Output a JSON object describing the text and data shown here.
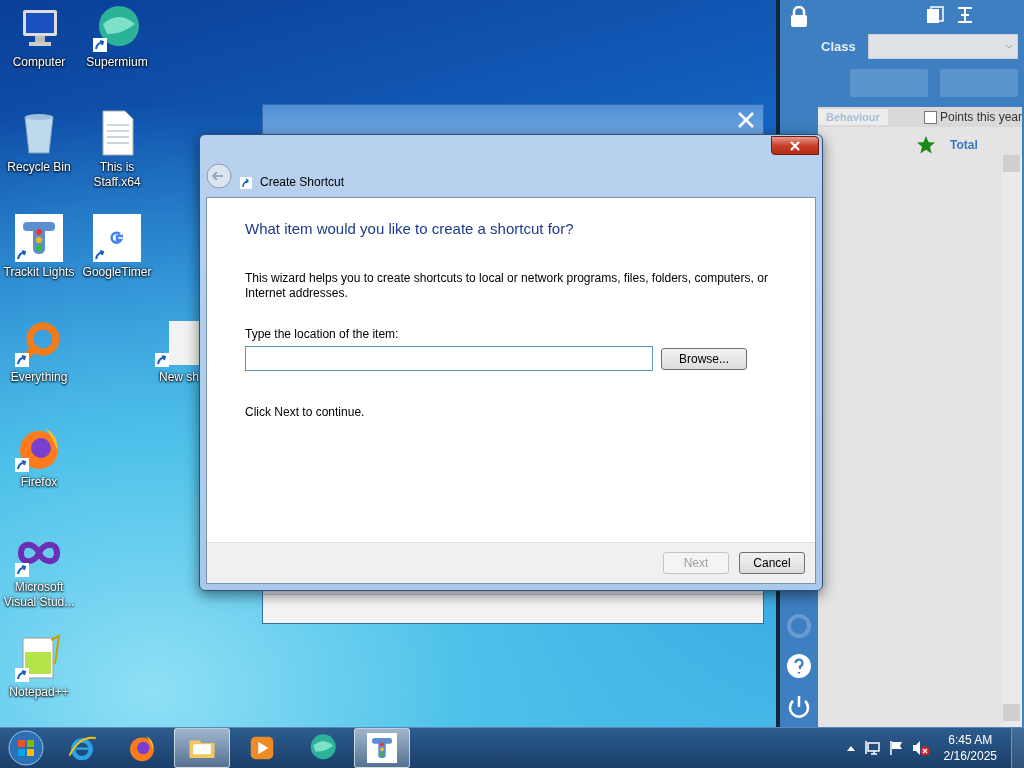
{
  "desktop_icons": [
    {
      "label": "Computer",
      "kind": "computer",
      "shortcut": false
    },
    {
      "label": "Supermium",
      "kind": "supermium",
      "shortcut": true
    },
    {
      "label": "Recycle Bin",
      "kind": "recycle-bin",
      "shortcut": false
    },
    {
      "label": "This is Staff.x64",
      "kind": "document",
      "shortcut": false
    },
    {
      "label": "Trackit Lights",
      "kind": "traffic-light",
      "shortcut": true
    },
    {
      "label": "GoogleTimer",
      "kind": "google",
      "shortcut": true
    },
    {
      "label": "Everything",
      "kind": "magnifier",
      "shortcut": true
    },
    {
      "label": "New sh",
      "kind": "blank",
      "shortcut": true
    },
    {
      "label": "Firefox",
      "kind": "firefox",
      "shortcut": true
    },
    {
      "label": "Microsoft Visual Stud...",
      "kind": "infinity",
      "shortcut": true
    },
    {
      "label": "Notepad++",
      "kind": "notepad",
      "shortcut": true
    }
  ],
  "dialog": {
    "title": "Create Shortcut",
    "heading": "What item would you like to create a shortcut for?",
    "description": "This wizard helps you to create shortcuts to local or network programs, files, folders, computers, or Internet addresses.",
    "field_label": "Type the location of the item:",
    "browse_button": "Browse...",
    "hint": "Click Next to continue.",
    "buttons": [
      {
        "label": "Next",
        "disabled": true
      },
      {
        "label": "Cancel",
        "disabled": false
      }
    ]
  },
  "trackit_panel": {
    "class_label": "Class",
    "behaviour_tab": {
      "label": "Behaviour",
      "disabled": true
    },
    "points_this_year": {
      "label": "Points this year",
      "checked": false
    },
    "total_header": "Total"
  },
  "taskbar": {
    "apps": [
      {
        "kind": "ie",
        "open": false
      },
      {
        "kind": "firefox",
        "open": false
      },
      {
        "kind": "explorer",
        "open": true
      },
      {
        "kind": "media",
        "open": false
      },
      {
        "kind": "supermium",
        "open": false
      },
      {
        "kind": "traffic-light",
        "open": true
      }
    ],
    "clock": {
      "time": "6:45 AM",
      "date": "2/16/2025"
    }
  }
}
